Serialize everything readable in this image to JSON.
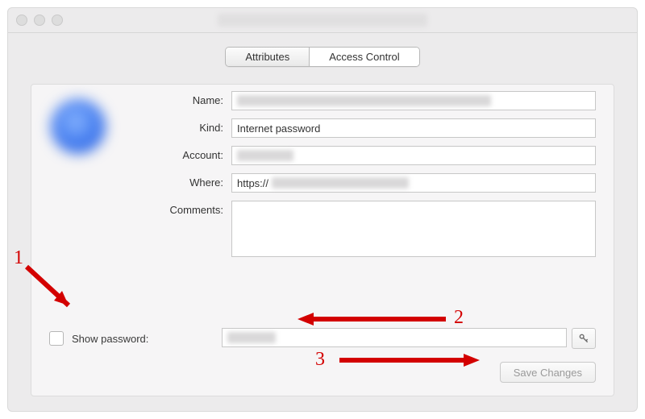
{
  "window": {
    "title_redacted": true
  },
  "tabs": {
    "attributes": "Attributes",
    "access_control": "Access Control",
    "selected": "attributes"
  },
  "labels": {
    "name": "Name:",
    "kind": "Kind:",
    "account": "Account:",
    "where": "Where:",
    "comments": "Comments:",
    "show_password": "Show password:"
  },
  "fields": {
    "name": "",
    "kind": "Internet password",
    "account": "",
    "where_prefix": "https://",
    "where_host": "",
    "comments": "",
    "password": ""
  },
  "buttons": {
    "save_changes": "Save Changes"
  },
  "icons": {
    "key": "key-icon"
  },
  "annotations": {
    "n1": "1",
    "n2": "2",
    "n3": "3"
  },
  "colors": {
    "accent_red": "#d30000",
    "panel_bg": "#f6f5f6",
    "window_bg": "#ecebec"
  }
}
